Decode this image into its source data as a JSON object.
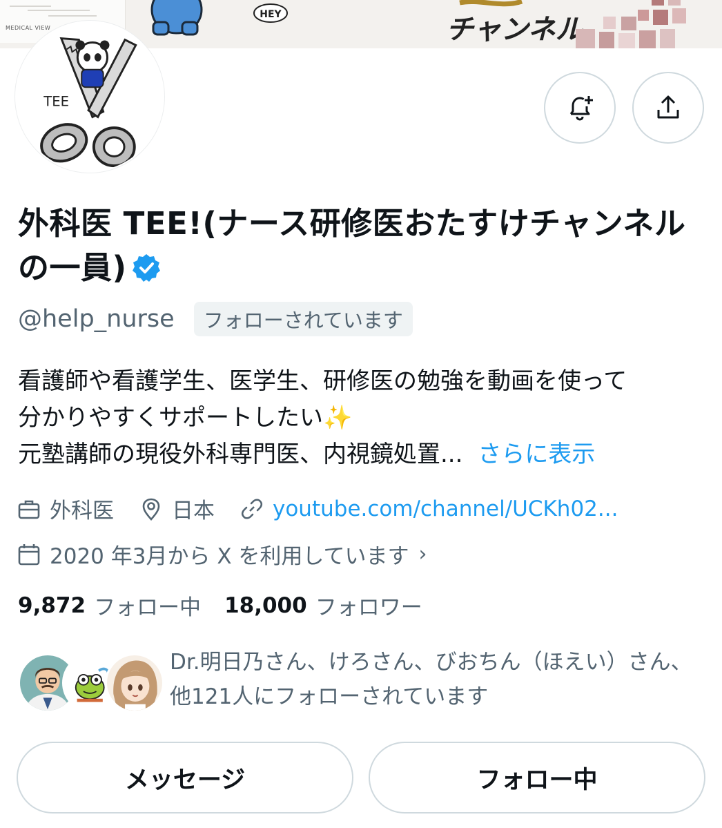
{
  "banner": {
    "publisher_brand": "MEDICAL VIEW",
    "hey_text": "HEY",
    "brush_text": "チャンネル",
    "tile_color": "#cdb4b4"
  },
  "avatar": {
    "icon": "scissors-panda-avatar",
    "lettering": "TEE"
  },
  "actions": {
    "notify_icon": "bell-plus-icon",
    "share_icon": "share-upload-icon"
  },
  "profile": {
    "display_name": "外科医 TEE!(ナース研修医おたすけチャンネルの一員)",
    "verified": true,
    "handle": "@help_nurse",
    "follows_you_label": "フォローされています",
    "bio_line1": "看護師や看護学生、医学生、研修医の勉強を動画を使って",
    "bio_line2": "分かりやすくサポートしたい",
    "bio_line2_emoji": "✨",
    "bio_line3": "元塾講師の現役外科専門医、内視鏡処置...",
    "see_more": "さらに表示"
  },
  "meta": {
    "category": "外科医",
    "location": "日本",
    "link": "youtube.com/channel/UCKh02...",
    "joined": "2020 年3月から X を利用しています",
    "joined_chevron": "›"
  },
  "counts": {
    "following_count": "9,872",
    "following_label": "フォロー中",
    "followers_count": "18,000",
    "followers_label": "フォロワー"
  },
  "followed_by": {
    "text": "Dr.明日乃さん、けろさん、びおちん（ほえい）さん、他121人にフォローされています"
  },
  "buttons": {
    "message": "メッセージ",
    "following": "フォロー中"
  },
  "colors": {
    "accent": "#1d9bf0",
    "secondary_text": "#536471",
    "border": "#cfd9de"
  }
}
